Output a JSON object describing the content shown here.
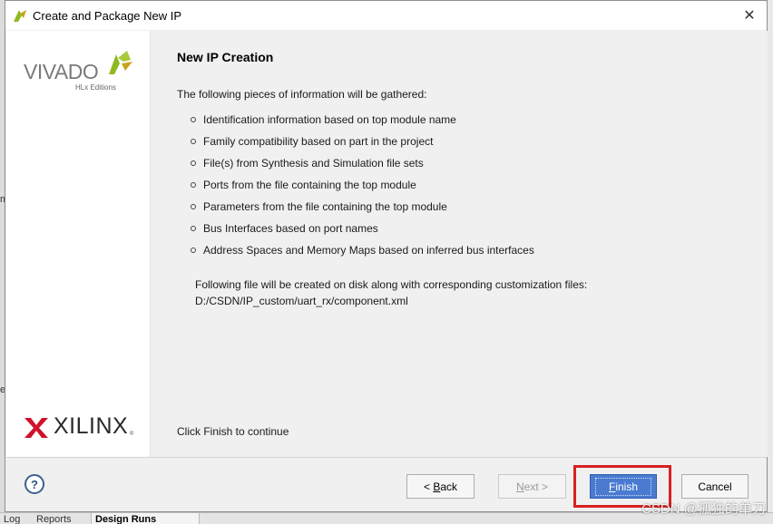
{
  "window": {
    "title": "Create and Package New IP",
    "close_glyph": "✕"
  },
  "branding": {
    "vivado_text": "VIVADO",
    "vivado_sub": "HLx Editions",
    "xilinx_text": "XILINX",
    "xilinx_reg": "®"
  },
  "page": {
    "heading": "New IP Creation",
    "intro": "The following pieces of information will be gathered:",
    "items": [
      {
        "label": "Identification information based on top module name"
      },
      {
        "label": "Family compatibility based on part in the project"
      },
      {
        "label": "File(s) from Synthesis and Simulation file sets"
      },
      {
        "label": "Ports from the file containing the top module"
      },
      {
        "label": "Parameters from the file containing the top module"
      },
      {
        "label": "Bus Interfaces based on port names"
      },
      {
        "label": "Address Spaces and Memory Maps based on inferred bus interfaces"
      }
    ],
    "file_note": "Following file will be created on disk along with corresponding customization files:",
    "file_path": "D:/CSDN/IP_custom/uart_rx/component.xml",
    "finish_hint": "Click Finish to continue"
  },
  "buttons": {
    "help": "?",
    "back_prefix": "< ",
    "back_mnemonic": "B",
    "back_rest": "ack",
    "next_mnemonic": "N",
    "next_rest": "ext >",
    "finish_mnemonic": "F",
    "finish_rest": "inish",
    "cancel": "Cancel"
  },
  "background_app": {
    "tabs": [
      "Log",
      "Reports",
      "Design Runs"
    ],
    "fragments": [
      "m",
      "e"
    ]
  },
  "watermark": "CSDN @孤独的单刀",
  "colors": {
    "finish_button": "#4a7bd0",
    "highlight_border": "#d82020",
    "vivado_accent": "#8dba1e"
  }
}
